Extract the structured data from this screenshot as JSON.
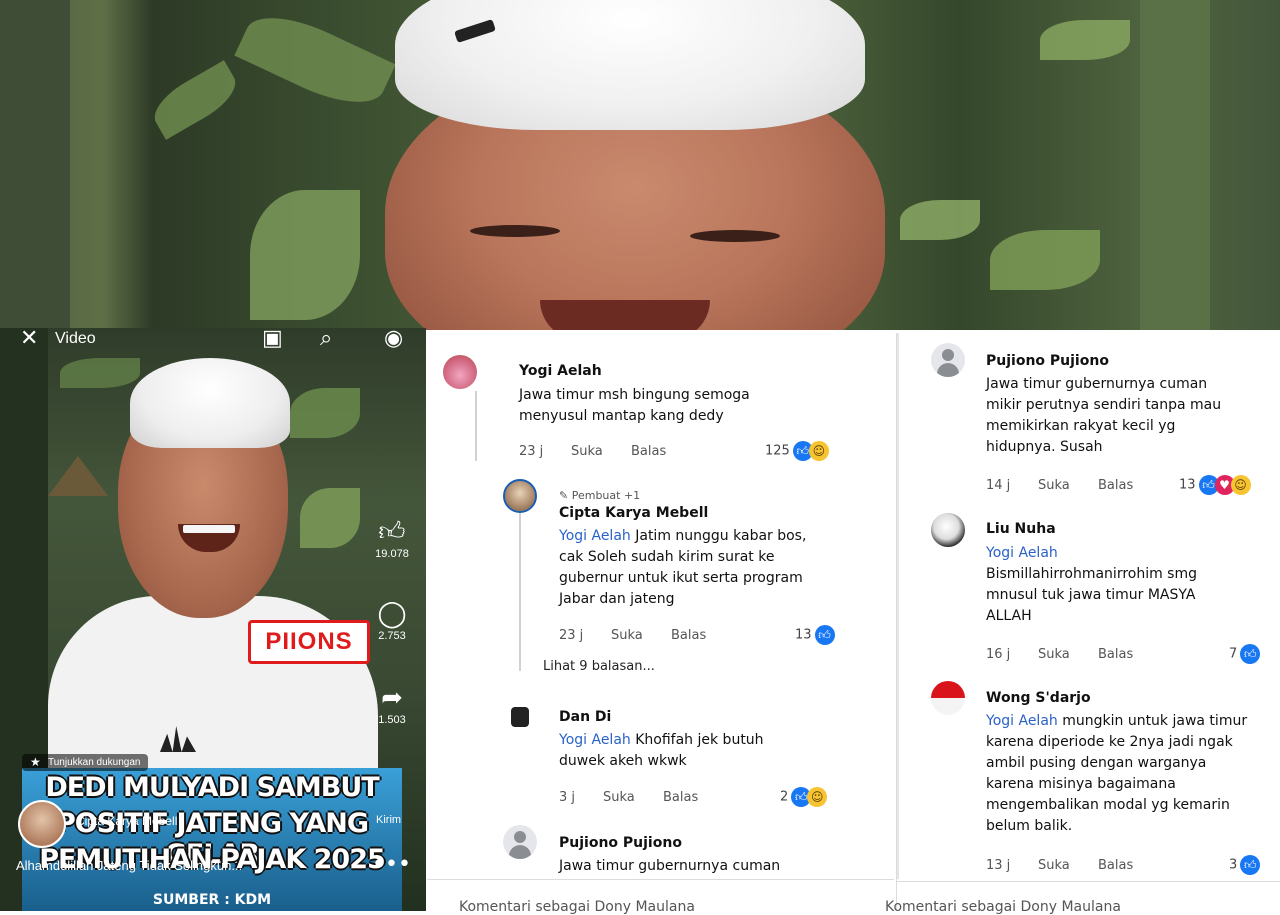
{
  "video_header": {
    "title": "Video",
    "close_icon": "close-icon",
    "camera_icon": "camera-icon",
    "search_icon": "search-icon",
    "profile_icon": "profile-icon"
  },
  "side_actions": {
    "likes": "19.078",
    "comments": "2.753",
    "shares": "1.503",
    "send_label": "Kirim"
  },
  "support_badge": "Tunjukkan dukungan",
  "watermark": "PIIONS",
  "headline": {
    "line1": "DEDI MULYADI SAMBUT",
    "line2": "POSITIF JATENG YANG GELAR",
    "line3": "PEMUTIHAN PAJAK 2025",
    "source": "SUMBER : KDM"
  },
  "caption": {
    "user": "Cipta Karya Mebell",
    "text": "Alhamdulillah Jateng Tidak Selingkuh..."
  },
  "comments_a": [
    {
      "name": "Yogi Aelah",
      "text": "Jawa timur msh bingung  semoga menyusul  mantap kang dedy",
      "time": "23 j",
      "like": "Suka",
      "reply": "Balas",
      "count": "125"
    },
    {
      "author_badge": "Pembuat +1",
      "name": "Cipta Karya Mebell",
      "mention": "Yogi Aelah",
      "text": " Jatim nunggu kabar bos, cak Soleh sudah kirim surat ke gubernur untuk ikut serta program Jabar dan jateng",
      "time": "23 j",
      "like": "Suka",
      "reply": "Balas",
      "count": "13"
    },
    {
      "view_replies": "Lihat 9 balasan..."
    },
    {
      "name": "Dan Di",
      "mention": "Yogi Aelah",
      "text": " Khofifah jek butuh duwek akeh wkwk",
      "time": "3 j",
      "like": "Suka",
      "reply": "Balas",
      "count": "2"
    },
    {
      "name": "Pujiono Pujiono",
      "text": "Jawa timur gubernurnya cuman"
    }
  ],
  "comments_b": [
    {
      "name": "Pujiono Pujiono",
      "text": "Jawa timur gubernurnya cuman mikir perutnya sendiri tanpa mau memikirkan rakyat kecil yg hidupnya. Susah",
      "time": "14 j",
      "like": "Suka",
      "reply": "Balas",
      "count": "13"
    },
    {
      "name": "Liu Nuha",
      "mention": "Yogi Aelah",
      "text": "Bismillahirrohmanirrohim smg mnusul tuk jawa timur MASYA ALLAH",
      "time": "16 j",
      "like": "Suka",
      "reply": "Balas",
      "count": "7"
    },
    {
      "name": "Wong S'darjo",
      "mention": "Yogi Aelah",
      "text": " mungkin untuk jawa timur karena diperiode ke 2nya jadi ngak ambil pusing dengan warganya karena misinya bagaimana mengembalikan modal yg kemarin belum balik.",
      "time": "13 j",
      "like": "Suka",
      "reply": "Balas",
      "count": "3"
    }
  ],
  "input_placeholder": "Komentari sebagai Dony Maulana"
}
